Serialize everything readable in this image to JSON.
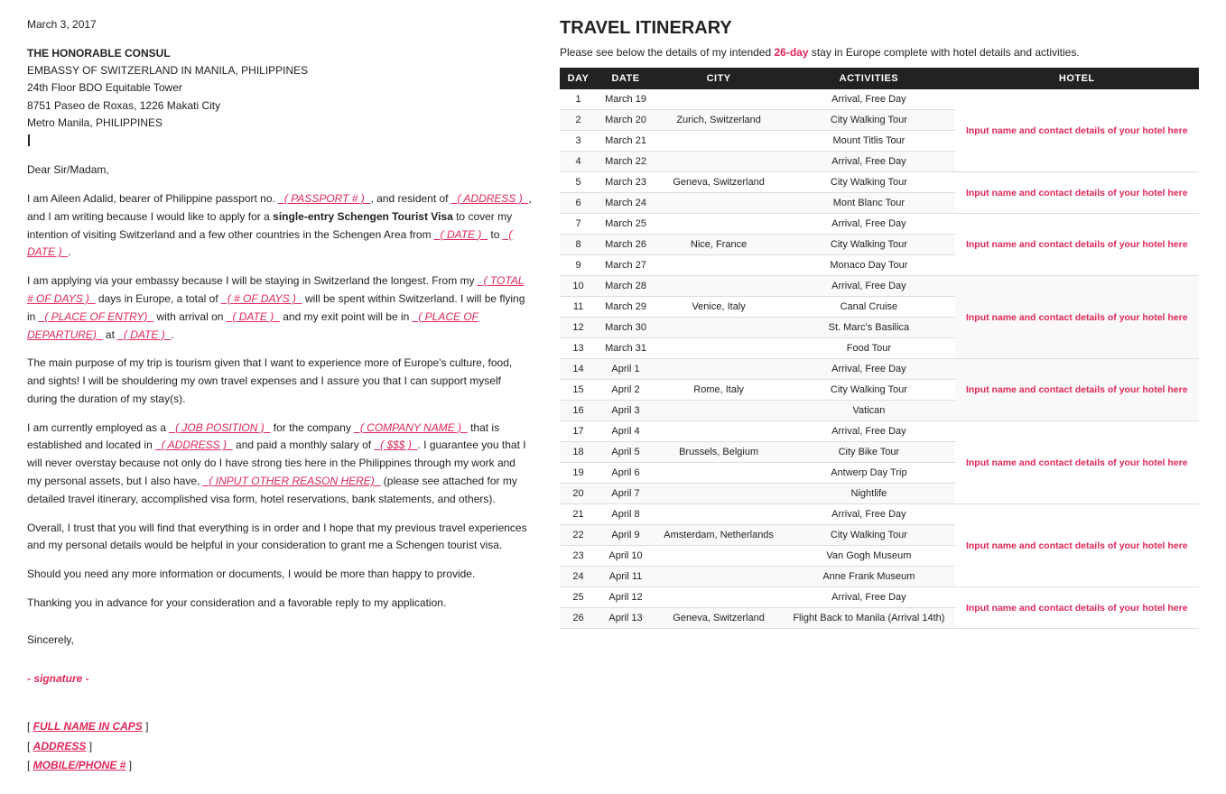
{
  "header": {
    "date": "March 3, 2017"
  },
  "addressee": {
    "title": "THE HONORABLE CONSUL",
    "line1": "EMBASSY OF SWITZERLAND IN MANILA, PHILIPPINES",
    "line2": "24th Floor BDO Equitable Tower",
    "line3": "8751 Paseo de Roxas, 1226 Makati City",
    "line4": "Metro Manila, PHILIPPINES"
  },
  "salutation": "Dear Sir/Madam,",
  "paragraphs": {
    "p1": "I am Aileen Adalid, bearer of Philippine passport no.",
    "p1_ph1": "_( PASSPORT # )_",
    "p1_mid": ", and resident of",
    "p1_ph2": "_( ADDRESS )_",
    "p1_end": ", and I am writing because I would like to apply for a",
    "p1_bold": "single-entry Schengen Tourist Visa",
    "p1_end2": "to cover my intention of visiting Switzerland and a few other countries in the Schengen Area from",
    "p1_ph3": "_( DATE )_",
    "p1_to": "to",
    "p1_ph4": "_( DATE )_",
    "p1_dot": ".",
    "p2_start": "I am applying via your embassy because I will be staying in Switzerland the longest. From my",
    "p2_ph1": "_( TOTAL # OF DAYS )_",
    "p2_mid": "days in Europe, a total of",
    "p2_ph2": "_( # OF DAYS )_",
    "p2_mid2": "will be spent within Switzerland. I will be flying in",
    "p2_ph3": "_( PLACE OF ENTRY)_",
    "p2_mid3": "with arrival on",
    "p2_ph4": "_( DATE )_",
    "p2_mid4": "and my exit point will be in",
    "p2_ph5": "_( PLACE OF DEPARTURE)_",
    "p2_mid5": "at",
    "p2_ph6": "_( DATE )_",
    "p2_dot": ".",
    "p3": "The main purpose of my trip is tourism given that I want to experience more of Europe's culture, food, and sights! I will be shouldering my own travel expenses and I assure you that I can support myself during the duration of my stay(s).",
    "p4_start": "I am currently employed as a",
    "p4_ph1": "_( JOB POSITION )_",
    "p4_mid": "for the company",
    "p4_ph2": "_( COMPANY NAME )_",
    "p4_mid2": "that is established and located in",
    "p4_ph3": "_( ADDRESS )_",
    "p4_mid3": "and paid a monthly salary of",
    "p4_ph4": "_( $$$ )_",
    "p4_mid4": ". I guarantee you that I will never overstay because not only do I have strong ties here in the Philippines through my work and my personal assets, but I also have,",
    "p4_ph5": "_( INPUT OTHER REASON HERE)_",
    "p4_end": "(please see attached for my detailed travel itinerary, accomplished visa form, hotel reservations, bank statements, and others).",
    "p5": "Overall, I trust that you will find that everything is in order and I hope that my previous travel experiences and my personal details would be helpful in your consideration to grant me a Schengen tourist visa.",
    "p6": "Should you need any more information or documents, I would be more than happy to provide.",
    "p7": "Thanking you in advance for your consideration and a favorable reply to my application."
  },
  "closing": {
    "sincerely": "Sincerely,",
    "signature": "- signature -",
    "fullname_label": "[ ",
    "fullname_ph": "FULL NAME IN CAPS",
    "fullname_end": "]",
    "address_label": "[ ",
    "address_ph": "ADDRESS",
    "address_end": "]",
    "phone_label": "[ ",
    "phone_ph": "MOBILE/PHONE #",
    "phone_end": " ]"
  },
  "itinerary": {
    "title": "TRAVEL ITINERARY",
    "subtitle_before": "Please see below the details of my intended ",
    "days_count": "26-day",
    "subtitle_after": " stay in Europe complete with hotel details and activities.",
    "columns": [
      "DAY",
      "DATE",
      "CITY",
      "ACTIVITIES",
      "HOTEL"
    ],
    "hotel_placeholder": "Input name and contact details of your hotel here",
    "rows": [
      {
        "day": "1",
        "date": "March 19",
        "city": "",
        "activity": "Arrival, Free Day",
        "hotel_group": 1
      },
      {
        "day": "2",
        "date": "March 20",
        "city": "Zurich, Switzerland",
        "activity": "City Walking Tour",
        "hotel_group": 1
      },
      {
        "day": "3",
        "date": "March 21",
        "city": "",
        "activity": "Mount Titlis Tour",
        "hotel_group": 1
      },
      {
        "day": "4",
        "date": "March 22",
        "city": "",
        "activity": "Arrival, Free Day",
        "hotel_group": 1
      },
      {
        "day": "5",
        "date": "March 23",
        "city": "Geneva, Switzerland",
        "activity": "City Walking Tour",
        "hotel_group": 2
      },
      {
        "day": "6",
        "date": "March 24",
        "city": "",
        "activity": "Mont Blanc Tour",
        "hotel_group": 2
      },
      {
        "day": "7",
        "date": "March 25",
        "city": "",
        "activity": "Arrival, Free Day",
        "hotel_group": 3
      },
      {
        "day": "8",
        "date": "March 26",
        "city": "Nice, France",
        "activity": "City Walking Tour",
        "hotel_group": 3
      },
      {
        "day": "9",
        "date": "March 27",
        "city": "",
        "activity": "Monaco Day Tour",
        "hotel_group": 3
      },
      {
        "day": "10",
        "date": "March 28",
        "city": "",
        "activity": "Arrival, Free Day",
        "hotel_group": 4
      },
      {
        "day": "11",
        "date": "March 29",
        "city": "Venice, Italy",
        "activity": "Canal Cruise",
        "hotel_group": 4
      },
      {
        "day": "12",
        "date": "March 30",
        "city": "",
        "activity": "St. Marc's Basilica",
        "hotel_group": 4
      },
      {
        "day": "13",
        "date": "March 31",
        "city": "",
        "activity": "Food Tour",
        "hotel_group": 4
      },
      {
        "day": "14",
        "date": "April 1",
        "city": "",
        "activity": "Arrival, Free Day",
        "hotel_group": 5
      },
      {
        "day": "15",
        "date": "April 2",
        "city": "Rome, Italy",
        "activity": "City Walking Tour",
        "hotel_group": 5
      },
      {
        "day": "16",
        "date": "April 3",
        "city": "",
        "activity": "Vatican",
        "hotel_group": 5
      },
      {
        "day": "17",
        "date": "April 4",
        "city": "",
        "activity": "Arrival, Free Day",
        "hotel_group": 6
      },
      {
        "day": "18",
        "date": "April 5",
        "city": "Brussels, Belgium",
        "activity": "City Bike Tour",
        "hotel_group": 6
      },
      {
        "day": "19",
        "date": "April 6",
        "city": "",
        "activity": "Antwerp Day Trip",
        "hotel_group": 6
      },
      {
        "day": "20",
        "date": "April 7",
        "city": "",
        "activity": "Nightlife",
        "hotel_group": 6
      },
      {
        "day": "21",
        "date": "April 8",
        "city": "",
        "activity": "Arrival, Free Day",
        "hotel_group": 7
      },
      {
        "day": "22",
        "date": "April 9",
        "city": "Amsterdam, Netherlands",
        "activity": "City Walking Tour",
        "hotel_group": 7
      },
      {
        "day": "23",
        "date": "April 10",
        "city": "",
        "activity": "Van Gogh Museum",
        "hotel_group": 7
      },
      {
        "day": "24",
        "date": "April 11",
        "city": "",
        "activity": "Anne Frank Museum",
        "hotel_group": 7
      },
      {
        "day": "25",
        "date": "April 12",
        "city": "",
        "activity": "Arrival, Free Day",
        "hotel_group": 8
      },
      {
        "day": "26",
        "date": "April 13",
        "city": "Geneva, Switzerland",
        "activity": "Flight Back to Manila (Arrival 14th)",
        "hotel_group": 8
      }
    ]
  }
}
